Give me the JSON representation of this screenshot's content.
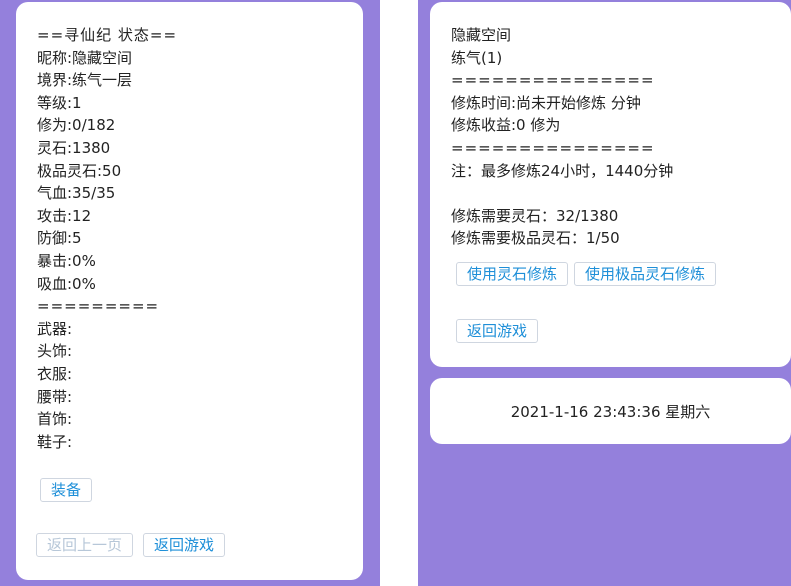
{
  "status_panel": {
    "title": "==寻仙纪 状态==",
    "stats": [
      "昵称:隐藏空间",
      "境界:练气一层",
      "等级:1",
      "修为:0/182",
      "灵石:1380",
      "极品灵石:50",
      "气血:35/35",
      "攻击:12",
      "防御:5",
      "暴击:0%",
      "吸血:0%"
    ],
    "separator": "=========",
    "equipment": [
      "武器:",
      "头饰:",
      "衣服:",
      "腰带:",
      "首饰:",
      "鞋子:"
    ],
    "equip_button": "装备",
    "prev_page_button": "返回上一页",
    "back_button": "返回游戏"
  },
  "cultivation_panel": {
    "name": "隐藏空间",
    "realm": "练气(1)",
    "separator": "===============",
    "time": "修炼时间:尚未开始修炼 分钟",
    "gain": "修炼收益:0 修为",
    "note": "注：最多修炼24小时，1440分钟",
    "need_stone": "修炼需要灵石：32/1380",
    "need_premium": "修炼需要极品灵石：1/50",
    "use_stone_button": "使用灵石修炼",
    "use_premium_button": "使用极品灵石修炼",
    "back_button": "返回游戏"
  },
  "footer": {
    "datetime": "2021-1-16 23:43:36 星期六"
  },
  "colors": {
    "background": "#9480dc",
    "link": "#1e8fd8"
  }
}
